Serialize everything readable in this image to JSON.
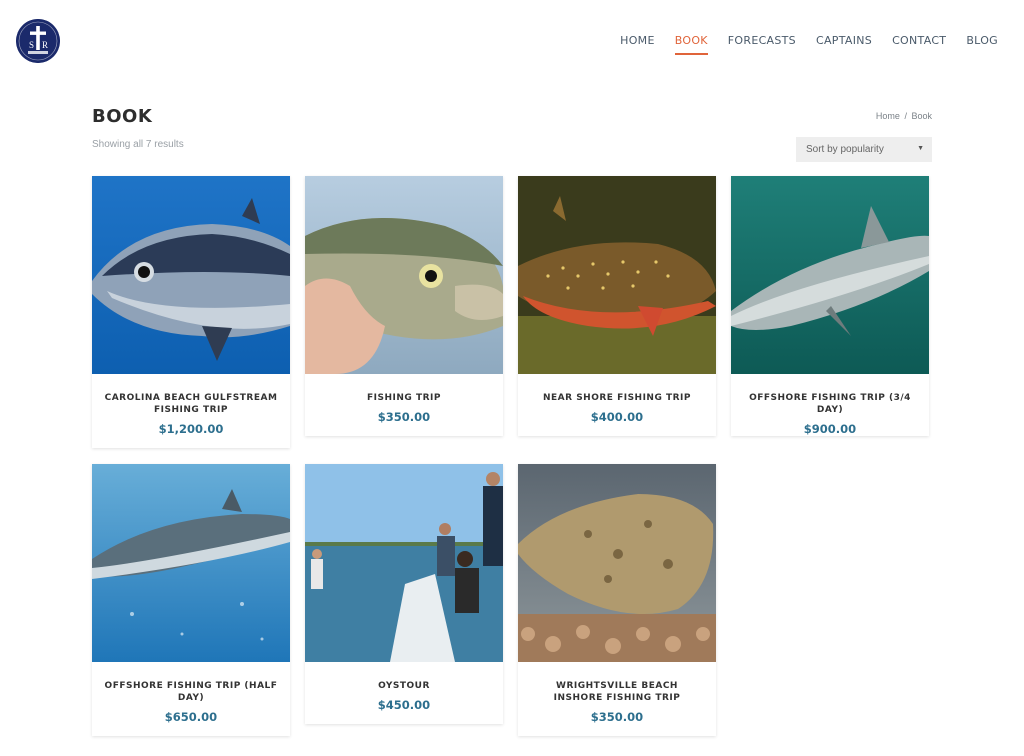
{
  "brand": {
    "logo_text": "SR"
  },
  "nav": {
    "items": [
      {
        "label": "HOME",
        "active": false
      },
      {
        "label": "BOOK",
        "active": true
      },
      {
        "label": "FORECASTS",
        "active": false
      },
      {
        "label": "CAPTAINS",
        "active": false
      },
      {
        "label": "CONTACT",
        "active": false
      },
      {
        "label": "BLOG",
        "active": false
      }
    ],
    "active_color": "#e0643a"
  },
  "page": {
    "title": "BOOK",
    "breadcrumb": {
      "home": "Home",
      "separator": "/",
      "current": "Book"
    },
    "results_text": "Showing all 7 results",
    "sort": {
      "selected": "Sort by popularity"
    }
  },
  "products": [
    {
      "name": "CAROLINA BEACH GULFSTREAM FISHING TRIP",
      "price": "$1,200.00",
      "image": "tuna-underwater"
    },
    {
      "name": "FISHING TRIP",
      "price": "$350.00",
      "image": "bluefish-in-hand"
    },
    {
      "name": "NEAR SHORE FISHING TRIP",
      "price": "$400.00",
      "image": "speckled-trout"
    },
    {
      "name": "OFFSHORE FISHING TRIP (3/4 DAY)",
      "price": "$900.00",
      "image": "shark-underwater"
    },
    {
      "name": "OFFSHORE FISHING TRIP (HALF DAY)",
      "price": "$650.00",
      "image": "king-mackerel"
    },
    {
      "name": "OYSTOUR",
      "price": "$450.00",
      "image": "people-on-boat"
    },
    {
      "name": "WRIGHTSVILLE BEACH INSHORE FISHING TRIP",
      "price": "$350.00",
      "image": "flounder"
    }
  ],
  "colors": {
    "price": "#2d6f8e",
    "accent": "#e0643a",
    "logo_bg": "#1b2a6b"
  }
}
